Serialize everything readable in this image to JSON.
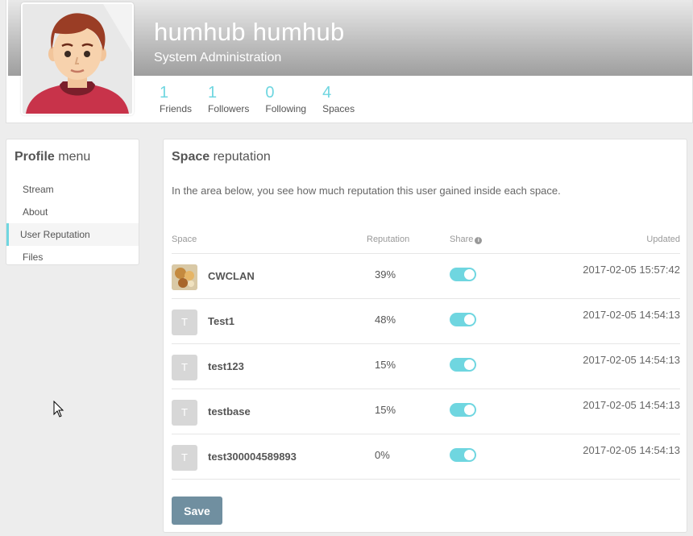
{
  "profile": {
    "name": "humhub humhub",
    "subtitle": "System Administration",
    "stats": [
      {
        "count": "1",
        "label": "Friends"
      },
      {
        "count": "1",
        "label": "Followers"
      },
      {
        "count": "0",
        "label": "Following"
      },
      {
        "count": "4",
        "label": "Spaces"
      }
    ]
  },
  "sidebar": {
    "title_bold": "Profile",
    "title_rest": " menu",
    "items": [
      {
        "label": "Stream"
      },
      {
        "label": "About"
      },
      {
        "label": "User Reputation"
      },
      {
        "label": "Files"
      }
    ]
  },
  "panel": {
    "title_bold": "Space",
    "title_rest": " reputation",
    "description": "In the area below, you see how much reputation this user gained inside each space.",
    "columns": {
      "space": "Space",
      "reputation": "Reputation",
      "share": "Share",
      "updated": "Updated"
    },
    "rows": [
      {
        "initial": "",
        "name": "CWCLAN",
        "reputation": "39%",
        "share": true,
        "updated": "2017-02-05 15:57:42"
      },
      {
        "initial": "T",
        "name": "Test1",
        "reputation": "48%",
        "share": true,
        "updated": "2017-02-05 14:54:13"
      },
      {
        "initial": "T",
        "name": "test123",
        "reputation": "15%",
        "share": true,
        "updated": "2017-02-05 14:54:13"
      },
      {
        "initial": "T",
        "name": "testbase",
        "reputation": "15%",
        "share": true,
        "updated": "2017-02-05 14:54:13"
      },
      {
        "initial": "T",
        "name": "test300004589893",
        "reputation": "0%",
        "share": true,
        "updated": "2017-02-05 14:54:13"
      }
    ],
    "save_label": "Save"
  },
  "colors": {
    "accent": "#6fd6e0",
    "save_button": "#708fa0"
  }
}
